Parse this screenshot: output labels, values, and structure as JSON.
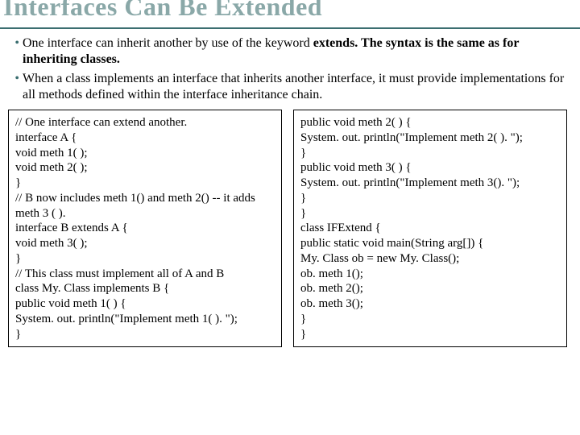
{
  "title": "Interfaces Can Be Extended",
  "bullets": [
    {
      "pre": "One interface can inherit another by use of the keyword ",
      "bold": "extends. The syntax is the same as for inheriting classes."
    },
    {
      "pre": "When a class implements an interface that inherits another interface, it must provide implementations for all methods defined within the interface inheritance chain.",
      "bold": ""
    }
  ],
  "code_left": "// One interface can extend another.\ninterface A {\nvoid meth 1( );\nvoid meth 2( );\n}\n// B now includes meth 1() and meth 2() -- it adds meth 3 ( ).\ninterface B extends A {\nvoid meth 3( );\n}\n// This class must implement all of A and B\nclass My. Class implements B {\npublic void meth 1( ) {\nSystem. out. println(\"Implement meth 1( ). \");\n}",
  "code_right": "public void meth 2( ) {\nSystem. out. println(\"Implement meth 2( ). \");\n}\npublic void meth 3( ) {\nSystem. out. println(\"Implement meth 3(). \");\n}\n}\nclass IFExtend {\npublic static void main(String arg[]) {\nMy. Class ob = new My. Class();\nob. meth 1();\nob. meth 2();\nob. meth 3();\n}\n}"
}
